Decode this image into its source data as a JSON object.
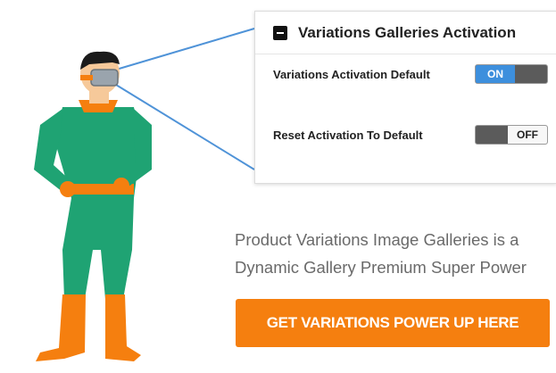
{
  "panel": {
    "title": "Variations Galleries Activation",
    "settings": [
      {
        "label": "Variations Activation Default",
        "toggle": "ON"
      },
      {
        "label": "Reset Activation To Default",
        "toggle": "OFF"
      }
    ]
  },
  "tagline": {
    "line1": "Product Variations Image Galleries is a",
    "line2": "Dynamic Gallery Premium Super Power"
  },
  "cta": {
    "label": "GET VARIATIONS POWER UP HERE"
  },
  "colors": {
    "accent_orange": "#f57f0f",
    "toggle_on_blue": "#3d8fdd",
    "hero_green": "#1fa373"
  },
  "icons": {
    "collapse": "minus-square-icon"
  }
}
